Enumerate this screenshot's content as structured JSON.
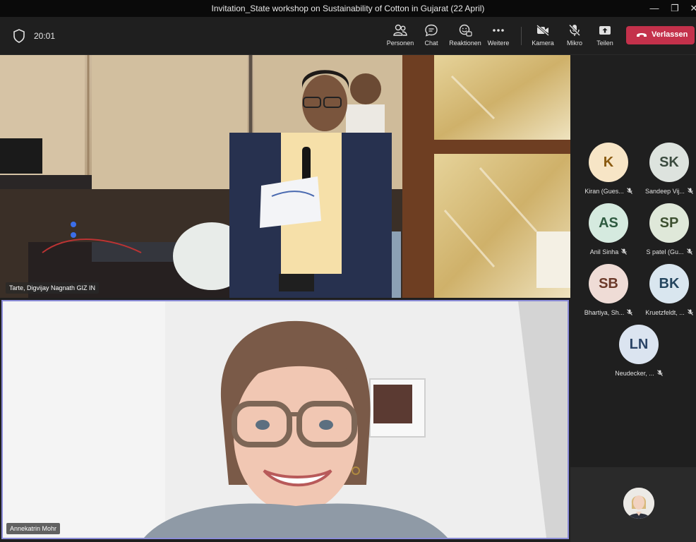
{
  "window": {
    "title": "Invitation_State workshop on Sustainability of Cotton in Gujarat (22 April)"
  },
  "toolbar": {
    "timer": "20:01",
    "items": [
      {
        "label": "Personen",
        "icon": "people-icon"
      },
      {
        "label": "Chat",
        "icon": "chat-icon"
      },
      {
        "label": "Reaktionen",
        "icon": "reactions-icon"
      },
      {
        "label": "Weitere",
        "icon": "more-icon"
      },
      {
        "label": "Kamera",
        "icon": "camera-off-icon"
      },
      {
        "label": "Mikro",
        "icon": "mic-off-icon"
      },
      {
        "label": "Teilen",
        "icon": "share-icon"
      }
    ],
    "leave_label": "Verlassen",
    "leave_color": "#c4314b"
  },
  "videos": {
    "top_name": "Tarte, Digvijay Nagnath GIZ IN",
    "bottom_name": "Annekatrin Mohr",
    "active_speaker_border": "#8b8cd8"
  },
  "participants": [
    {
      "initials": "K",
      "name": "Kiran (Gues...",
      "bg": "#f7e5c6",
      "fg": "#8a5a10"
    },
    {
      "initials": "SK",
      "name": "Sandeep Vij...",
      "bg": "#dde3de",
      "fg": "#3a4a3e"
    },
    {
      "initials": "AS",
      "name": "Anil Sinha",
      "bg": "#d5eadf",
      "fg": "#2e5a40"
    },
    {
      "initials": "SP",
      "name": "S patel (Gu...",
      "bg": "#dfe8d9",
      "fg": "#3d5030"
    },
    {
      "initials": "SB",
      "name": "Bhartiya, Sh...",
      "bg": "#efdcd6",
      "fg": "#6b3a2a"
    },
    {
      "initials": "BK",
      "name": "Kruetzfeldt, ...",
      "bg": "#d9e6ef",
      "fg": "#24455e"
    },
    {
      "initials": "LN",
      "name": "Neudecker, ...",
      "bg": "#dbe4f0",
      "fg": "#2b4466"
    }
  ]
}
